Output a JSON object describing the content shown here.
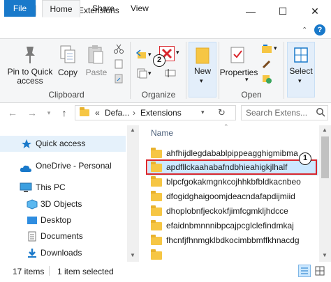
{
  "window": {
    "title": "Extensions",
    "minimize_glyph": "—",
    "maximize_glyph": "☐",
    "close_glyph": "✕"
  },
  "tabs": [
    "File",
    "Home",
    "Share",
    "View"
  ],
  "ribbon": {
    "clipboard": {
      "pin_label": "Pin to Quick\naccess",
      "pin_line1": "Pin to Quick",
      "pin_line2": "access",
      "copy_label": "Copy",
      "paste_label": "Paste",
      "group_label": "Clipboard"
    },
    "organize": {
      "group_label": "Organize",
      "badge": "2"
    },
    "new": {
      "new_label": "New"
    },
    "open": {
      "properties_label": "Properties",
      "group_label": "Open"
    },
    "select": {
      "select_label": "Select"
    }
  },
  "address": {
    "breadcrumb_prefix": "«",
    "segment1": "Defa...",
    "separator": "›",
    "segment2": "Extensions",
    "search_placeholder": "Search Extens..."
  },
  "nav": {
    "items": [
      {
        "label": "Quick access",
        "icon": "star-icon"
      },
      {
        "label": "OneDrive - Personal",
        "icon": "cloud-icon"
      },
      {
        "label": "This PC",
        "icon": "computer-icon"
      },
      {
        "label": "3D Objects",
        "icon": "cube-icon"
      },
      {
        "label": "Desktop",
        "icon": "desktop-icon"
      },
      {
        "label": "Documents",
        "icon": "documents-icon"
      },
      {
        "label": "Downloads",
        "icon": "downloads-icon"
      }
    ]
  },
  "filelist": {
    "column_name": "Name",
    "badge": "1",
    "rows": [
      "ahfhijdlegdabablpippeagghigmibma",
      "apdfllckaahabafndbhieahigkjlhalf",
      "blpcfgokakmgnkcojhhkbfbldkacnbeo",
      "dfogidghaigoomjdeacndafapdijmiid",
      "dhoplobnfjeckokfjimfcgmkljhdcce",
      "efaidnbmnnnibpcajpcglclefindmkaj",
      "fhcnfjfhnmgklbdkocimbbmffkhnacdg"
    ]
  },
  "status": {
    "items_count": "17 items",
    "selected": "1 item selected"
  }
}
